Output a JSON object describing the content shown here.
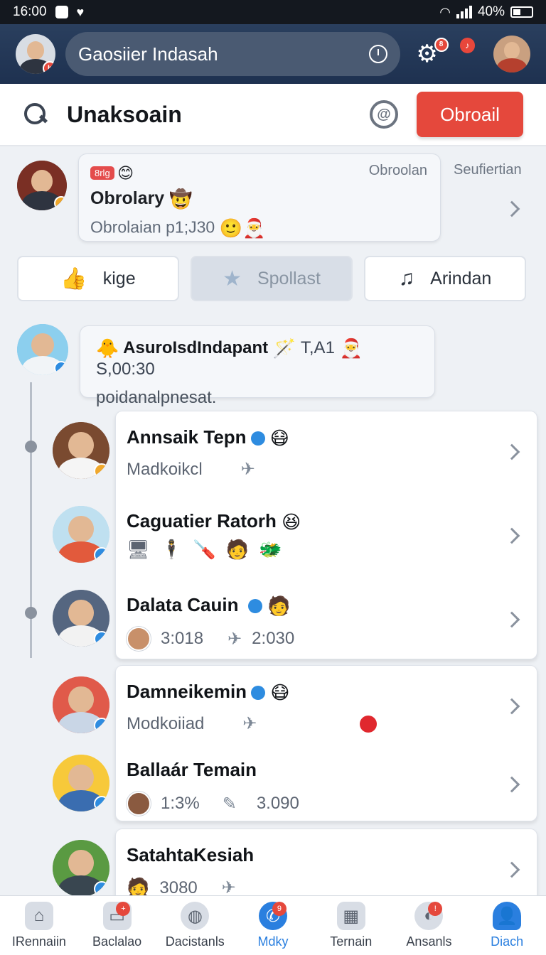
{
  "status_bar": {
    "time": "16:00",
    "battery": "40%"
  },
  "header": {
    "search_text": "Gaosiier Indasah",
    "notification_count": "8"
  },
  "title_bar": {
    "title": "Unaksoain",
    "button_label": "Obroail"
  },
  "top_post": {
    "tag": "8rlg",
    "name": "Obrolary",
    "subtitle": "Obrolaian p1;J30",
    "meta": "Obroolan",
    "side_label": "Seufiertian"
  },
  "chips": [
    {
      "label": "kige",
      "icon": "thumbs-up-icon"
    },
    {
      "label": "Spollast",
      "icon": "star-icon"
    },
    {
      "label": "Arindan",
      "icon": "music-icon"
    }
  ],
  "thread": {
    "name": "AsuroIsdIndapant",
    "time1": "T,A1",
    "time2": "S,00:30",
    "text": "poidanalpnesat."
  },
  "list": [
    {
      "name": "Annsaik Tepn",
      "detail": "Madkoikcl"
    },
    {
      "name": "Caguatier Ratorh",
      "detail": ""
    },
    {
      "name": "Dalata Cauin",
      "detail1": "3:018",
      "detail2": "2:030"
    },
    {
      "name": "Damneikemin",
      "detail": "Modkoiiad"
    },
    {
      "name": "Ballaár Temain",
      "detail1": "1:3%",
      "detail2": "3.090"
    },
    {
      "name": "SatahtaKesiah",
      "detail1": "3080"
    }
  ],
  "bottom_nav": [
    {
      "label": "IRennaiin",
      "badge": ""
    },
    {
      "label": "Baclalao",
      "badge": "+"
    },
    {
      "label": "Dacistanls",
      "badge": ""
    },
    {
      "label": "Mdky",
      "badge": "9"
    },
    {
      "label": "Ternain",
      "badge": ""
    },
    {
      "label": "Ansanls",
      "badge": "!"
    },
    {
      "label": "Diach",
      "badge": ""
    }
  ],
  "colors": {
    "accent": "#e5483c",
    "header_bg": "#1e3150",
    "active_nav": "#2a7fdf"
  }
}
